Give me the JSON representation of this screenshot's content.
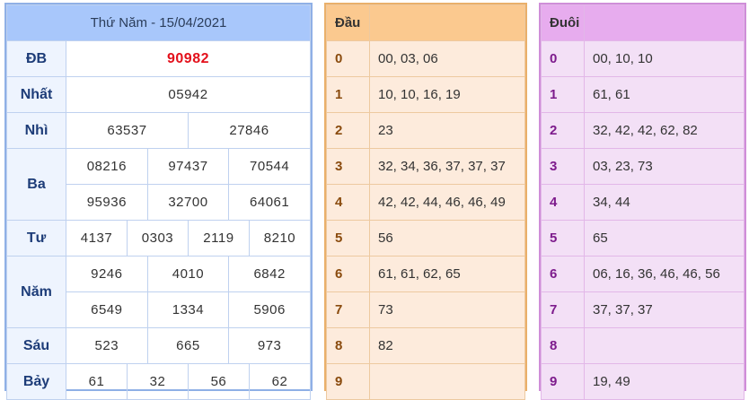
{
  "main": {
    "title": "Thứ Năm - 15/04/2021",
    "labels": {
      "db": "ĐB",
      "nhat": "Nhất",
      "nhi": "Nhì",
      "ba": "Ba",
      "tu": "Tư",
      "nam": "Năm",
      "sau": "Sáu",
      "bay": "Bảy"
    },
    "db": "90982",
    "nhat": "05942",
    "nhi": [
      "63537",
      "27846"
    ],
    "ba": [
      "08216",
      "97437",
      "70544",
      "95936",
      "32700",
      "64061"
    ],
    "tu": [
      "4137",
      "0303",
      "2119",
      "8210"
    ],
    "nam": [
      "9246",
      "4010",
      "6842",
      "6549",
      "1334",
      "5906"
    ],
    "sau": [
      "523",
      "665",
      "973"
    ],
    "bay": [
      "61",
      "32",
      "56",
      "62"
    ]
  },
  "dau": {
    "header": "Đầu",
    "rows": [
      {
        "k": "0",
        "v": "00, 03, 06"
      },
      {
        "k": "1",
        "v": "10, 10, 16, 19"
      },
      {
        "k": "2",
        "v": "23"
      },
      {
        "k": "3",
        "v": "32, 34, 36, 37, 37, 37"
      },
      {
        "k": "4",
        "v": "42, 42, 44, 46, 46, 49"
      },
      {
        "k": "5",
        "v": "56"
      },
      {
        "k": "6",
        "v": "61, 61, 62, 65"
      },
      {
        "k": "7",
        "v": "73"
      },
      {
        "k": "8",
        "v": "82"
      },
      {
        "k": "9",
        "v": ""
      }
    ]
  },
  "duoi": {
    "header": "Đuôi",
    "rows": [
      {
        "k": "0",
        "v": "00, 10, 10"
      },
      {
        "k": "1",
        "v": "61, 61"
      },
      {
        "k": "2",
        "v": "32, 42, 42, 62, 82"
      },
      {
        "k": "3",
        "v": "03, 23, 73"
      },
      {
        "k": "4",
        "v": "34, 44"
      },
      {
        "k": "5",
        "v": "65"
      },
      {
        "k": "6",
        "v": "06, 16, 36, 46, 46, 56"
      },
      {
        "k": "7",
        "v": "37, 37, 37"
      },
      {
        "k": "8",
        "v": ""
      },
      {
        "k": "9",
        "v": "19, 49"
      }
    ]
  }
}
